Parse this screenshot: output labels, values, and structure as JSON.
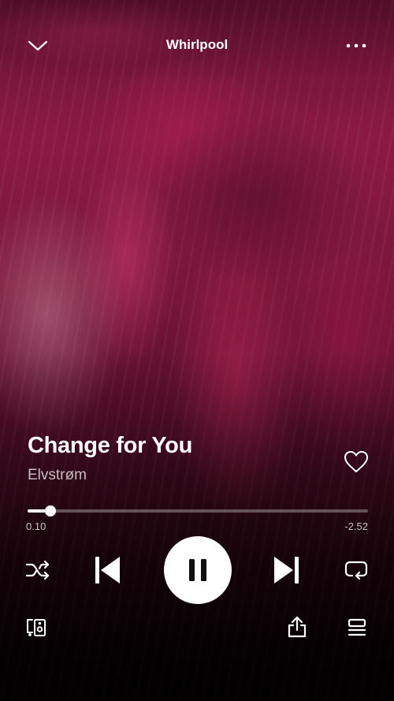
{
  "header": {
    "title": "Whirlpool",
    "collapse_icon": "chevron-down-icon",
    "more_icon": "more-options-icon"
  },
  "track": {
    "title": "Change for You",
    "artist": "Elvstrøm",
    "liked": false
  },
  "progress": {
    "elapsed": "0.10",
    "remaining": "-2.52",
    "fraction": 0.066
  },
  "controls": {
    "shuffle_icon": "shuffle-icon",
    "previous_icon": "skip-previous-icon",
    "play_state": "playing",
    "pause_icon": "pause-icon",
    "next_icon": "skip-next-icon",
    "repeat_icon": "repeat-icon"
  },
  "footer": {
    "devices_icon": "connect-devices-icon",
    "share_icon": "share-icon",
    "queue_icon": "queue-icon"
  },
  "colors": {
    "background_top": "#7a1639",
    "background_bottom": "#0b0105",
    "text_primary": "#ffffff",
    "text_secondary": "#c9b8bf"
  }
}
